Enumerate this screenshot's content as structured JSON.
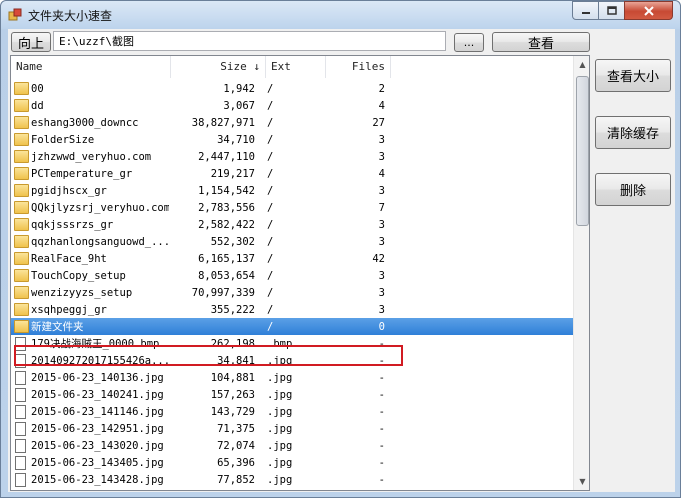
{
  "window": {
    "title": "文件夹大小速查"
  },
  "toolbar": {
    "up_label": "向上",
    "path_value": "E:\\uzzf\\截图",
    "browse_label": "...",
    "view_label": "查看"
  },
  "side": {
    "view_size_label": "查看大小",
    "clear_cache_label": "清除缓存",
    "delete_label": "删除"
  },
  "columns": {
    "name": "Name",
    "size": "Size ↓",
    "ext": "Ext",
    "files": "Files"
  },
  "rows": [
    {
      "type": "folder",
      "name": "00",
      "size": "1,942",
      "ext": "/",
      "files": "2"
    },
    {
      "type": "folder",
      "name": "dd",
      "size": "3,067",
      "ext": "/",
      "files": "4"
    },
    {
      "type": "folder",
      "name": "eshang3000_downcc",
      "size": "38,827,971",
      "ext": "/",
      "files": "27"
    },
    {
      "type": "folder",
      "name": "FolderSize",
      "size": "34,710",
      "ext": "/",
      "files": "3"
    },
    {
      "type": "folder",
      "name": "jzhzwwd_veryhuo.com",
      "size": "2,447,110",
      "ext": "/",
      "files": "3"
    },
    {
      "type": "folder",
      "name": "PCTemperature_gr",
      "size": "219,217",
      "ext": "/",
      "files": "4"
    },
    {
      "type": "folder",
      "name": "pgidjhscx_gr",
      "size": "1,154,542",
      "ext": "/",
      "files": "3"
    },
    {
      "type": "folder",
      "name": "QQkjlyzsrj_veryhuo.com",
      "size": "2,783,556",
      "ext": "/",
      "files": "7"
    },
    {
      "type": "folder",
      "name": "qqkjsssrzs_gr",
      "size": "2,582,422",
      "ext": "/",
      "files": "3"
    },
    {
      "type": "folder",
      "name": "qqzhanlongsanguowd_...",
      "size": "552,302",
      "ext": "/",
      "files": "3"
    },
    {
      "type": "folder",
      "name": "RealFace_9ht",
      "size": "6,165,137",
      "ext": "/",
      "files": "42"
    },
    {
      "type": "folder",
      "name": "TouchCopy_setup",
      "size": "8,053,654",
      "ext": "/",
      "files": "3"
    },
    {
      "type": "folder",
      "name": "wenzizyyzs_setup",
      "size": "70,997,339",
      "ext": "/",
      "files": "3"
    },
    {
      "type": "folder",
      "name": "xsqhpeggj_gr",
      "size": "355,222",
      "ext": "/",
      "files": "3"
    },
    {
      "type": "folder",
      "name": "新建文件夹",
      "size": "",
      "ext": "/",
      "files": "0",
      "selected": true
    },
    {
      "type": "file",
      "name": "179决战海贼王_0000.bmp",
      "size": "262,198",
      "ext": ".bmp",
      "files": "-"
    },
    {
      "type": "file",
      "name": "20140927201715542​6a...",
      "size": "34,841",
      "ext": ".jpg",
      "files": "-"
    },
    {
      "type": "file",
      "name": "2015-06-23_140136.jpg",
      "size": "104,881",
      "ext": ".jpg",
      "files": "-"
    },
    {
      "type": "file",
      "name": "2015-06-23_140241.jpg",
      "size": "157,263",
      "ext": ".jpg",
      "files": "-"
    },
    {
      "type": "file",
      "name": "2015-06-23_141146.jpg",
      "size": "143,729",
      "ext": ".jpg",
      "files": "-"
    },
    {
      "type": "file",
      "name": "2015-06-23_142951.jpg",
      "size": "71,375",
      "ext": ".jpg",
      "files": "-"
    },
    {
      "type": "file",
      "name": "2015-06-23_143020.jpg",
      "size": "72,074",
      "ext": ".jpg",
      "files": "-"
    },
    {
      "type": "file",
      "name": "2015-06-23_143405.jpg",
      "size": "65,396",
      "ext": ".jpg",
      "files": "-"
    },
    {
      "type": "file",
      "name": "2015-06-23_143428.jpg",
      "size": "77,852",
      "ext": ".jpg",
      "files": "-"
    }
  ],
  "icons": [
    "app-icon",
    "minimize-icon",
    "maximize-icon",
    "close-icon",
    "folder-icon",
    "file-icon",
    "scroll-up-icon",
    "scroll-down-icon"
  ],
  "colors": {
    "selection": "#3385db",
    "highlight_border": "#d11b22",
    "folder": "#f0c24c"
  }
}
